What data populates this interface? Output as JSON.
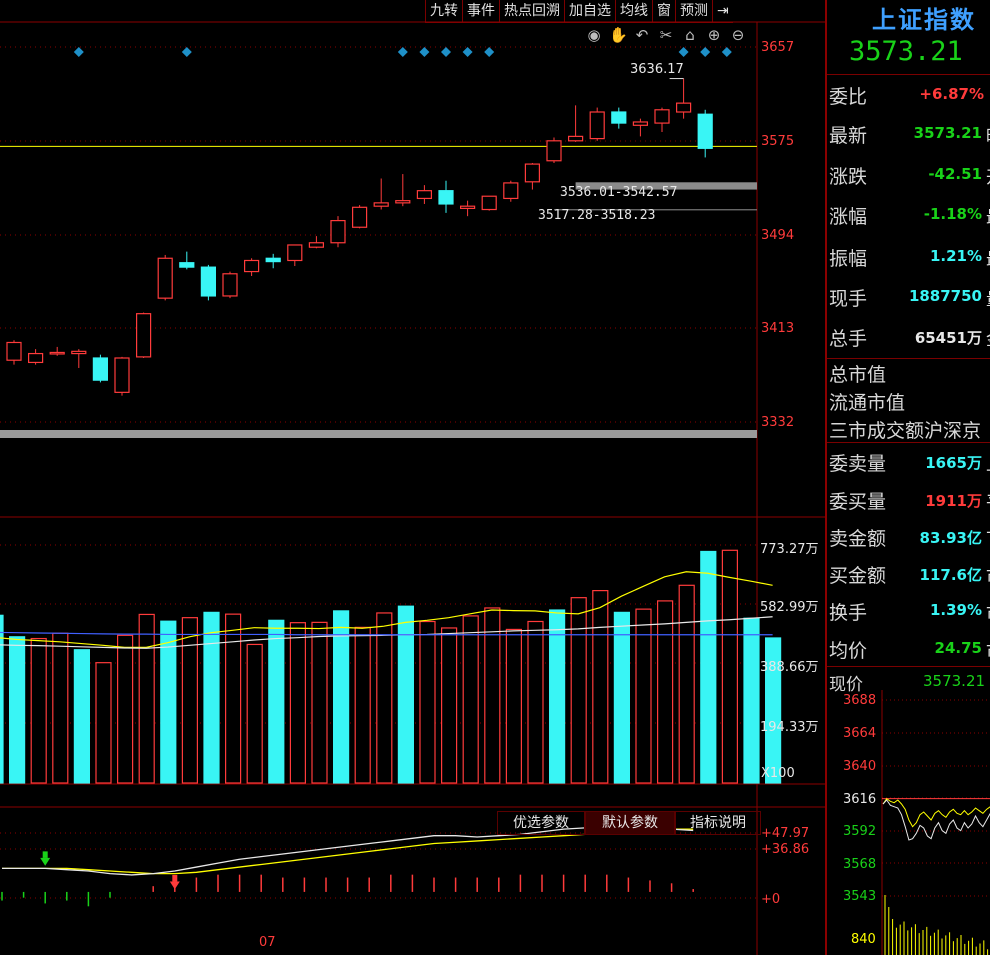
{
  "toolbar": {
    "items": [
      "九转",
      "事件",
      "热点回溯",
      "加自选",
      "均线",
      "窗",
      "预测",
      "⇥"
    ]
  },
  "chart_icons": [
    "eye-icon",
    "hand-icon",
    "undo-icon",
    "scissors-icon",
    "lock-icon",
    "zoom-in-icon",
    "zoom-out-icon"
  ],
  "colors": {
    "up": "#ff3b3b",
    "down": "#39f5f5",
    "ma_yellow": "#ffff00",
    "ma_white": "#e8e8e8",
    "ma_blue": "#4060ff",
    "grid": "#8b0000",
    "signal": "#1e90c8"
  },
  "chart_data": [
    {
      "type": "candlestick",
      "price_axis_ticks": [
        "3657",
        "3575",
        "3494",
        "3413",
        "3332"
      ],
      "ylim": [
        3310,
        3680
      ],
      "high_label": "3636.17",
      "gap_labels": [
        "3536.01-3542.57",
        "3517.28-3518.23"
      ],
      "gap_zones": [
        [
          3536.01,
          3542.57
        ],
        [
          3517.28,
          3518.23
        ]
      ],
      "reference_level": 3575,
      "signal_marker_bars": [
        3,
        8,
        18,
        19,
        20,
        21,
        22,
        31,
        32,
        33
      ],
      "candles": [
        {
          "o": 3382,
          "h": 3400,
          "l": 3378,
          "c": 3398
        },
        {
          "o": 3380,
          "h": 3392,
          "l": 3378,
          "c": 3388
        },
        {
          "o": 3388,
          "h": 3394,
          "l": 3386,
          "c": 3389
        },
        {
          "o": 3388,
          "h": 3392,
          "l": 3375,
          "c": 3390
        },
        {
          "o": 3384,
          "h": 3387,
          "l": 3362,
          "c": 3364
        },
        {
          "o": 3353,
          "h": 3385,
          "l": 3350,
          "c": 3384
        },
        {
          "o": 3385,
          "h": 3425,
          "l": 3384,
          "c": 3424
        },
        {
          "o": 3438,
          "h": 3477,
          "l": 3436,
          "c": 3474
        },
        {
          "o": 3470,
          "h": 3480,
          "l": 3464,
          "c": 3466
        },
        {
          "o": 3466,
          "h": 3468,
          "l": 3436,
          "c": 3440
        },
        {
          "o": 3440,
          "h": 3462,
          "l": 3438,
          "c": 3460
        },
        {
          "o": 3462,
          "h": 3474,
          "l": 3458,
          "c": 3472
        },
        {
          "o": 3474,
          "h": 3478,
          "l": 3465,
          "c": 3471
        },
        {
          "o": 3472,
          "h": 3479,
          "l": 3467,
          "c": 3486
        },
        {
          "o": 3484,
          "h": 3494,
          "l": 3483,
          "c": 3488
        },
        {
          "o": 3488,
          "h": 3512,
          "l": 3484,
          "c": 3508
        },
        {
          "o": 3502,
          "h": 3522,
          "l": 3501,
          "c": 3520
        },
        {
          "o": 3521,
          "h": 3546,
          "l": 3518,
          "c": 3524
        },
        {
          "o": 3524,
          "h": 3550,
          "l": 3521,
          "c": 3526
        },
        {
          "o": 3528,
          "h": 3540,
          "l": 3523,
          "c": 3535
        },
        {
          "o": 3535,
          "h": 3544,
          "l": 3515,
          "c": 3523
        },
        {
          "o": 3519,
          "h": 3526,
          "l": 3512,
          "c": 3521
        },
        {
          "o": 3518,
          "h": 3530,
          "l": 3517,
          "c": 3530
        },
        {
          "o": 3528,
          "h": 3544,
          "l": 3525,
          "c": 3542
        },
        {
          "o": 3543,
          "h": 3560,
          "l": 3536,
          "c": 3559
        },
        {
          "o": 3562,
          "h": 3583,
          "l": 3560,
          "c": 3580
        },
        {
          "o": 3580,
          "h": 3612,
          "l": 3579,
          "c": 3584
        },
        {
          "o": 3582,
          "h": 3610,
          "l": 3580,
          "c": 3606
        },
        {
          "o": 3606,
          "h": 3610,
          "l": 3591,
          "c": 3596
        },
        {
          "o": 3594,
          "h": 3600,
          "l": 3584,
          "c": 3597
        },
        {
          "o": 3596,
          "h": 3610,
          "l": 3588,
          "c": 3608
        },
        {
          "o": 3606,
          "h": 3636.17,
          "l": 3600,
          "c": 3614
        },
        {
          "o": 3604,
          "h": 3608,
          "l": 3565,
          "c": 3573.21
        }
      ]
    },
    {
      "type": "bar",
      "volume_axis_ticks": [
        "773.27万",
        "582.99万",
        "388.66万",
        "194.33万"
      ],
      "unit_label": "X100",
      "ylim": [
        0,
        860
      ],
      "values": [
        570,
        497,
        491,
        509,
        453,
        409,
        502,
        573,
        550,
        562,
        580,
        574,
        471,
        553,
        545,
        546,
        585,
        529,
        578,
        601,
        549,
        527,
        568,
        595,
        522,
        549,
        588,
        630,
        654,
        580,
        591,
        619,
        672,
        787,
        791,
        560,
        493
      ],
      "up_bars": [
        0,
        0,
        1,
        1,
        0,
        1,
        1,
        1,
        0,
        1,
        0,
        1,
        1,
        0,
        1,
        1,
        0,
        1,
        1,
        0,
        1,
        1,
        1,
        1,
        1,
        1,
        0,
        1,
        1,
        0,
        1,
        1,
        1,
        0,
        1,
        0,
        0
      ],
      "series": [
        {
          "values": [
            495,
            488,
            484,
            480,
            474,
            468,
            461,
            461,
            477,
            497,
            511,
            519,
            528,
            526,
            526,
            525,
            529,
            526,
            533,
            546,
            553,
            562,
            575,
            588,
            586,
            585,
            578,
            575,
            596,
            635,
            668,
            701,
            718,
            713,
            699,
            686,
            672
          ]
        },
        {
          "values": [
            470,
            468,
            467,
            465,
            463,
            461,
            459,
            458,
            462,
            468,
            474,
            480,
            486,
            491,
            494,
            498,
            500,
            501,
            502,
            504,
            505,
            508,
            511,
            514,
            517,
            519,
            521,
            524,
            529,
            533,
            537,
            541,
            546,
            551,
            555,
            560,
            565
          ]
        },
        {
          "values": [
            512,
            511,
            510,
            509,
            508,
            507,
            506,
            506,
            505,
            505,
            505,
            505,
            505,
            505,
            504,
            504,
            504,
            504,
            504,
            504,
            504,
            504,
            504,
            504,
            504,
            504,
            504,
            504,
            504,
            504,
            504,
            504,
            504,
            504,
            504,
            504,
            504
          ]
        }
      ]
    },
    {
      "type": "line",
      "indicator_axis_ticks": [
        "+47.97",
        "+36.86",
        "+0"
      ],
      "x_tick_label": "07",
      "ylim": [
        -10,
        55
      ],
      "series": [
        {
          "values": [
            18,
            18,
            18,
            18,
            17,
            16,
            15,
            14,
            14,
            15,
            17,
            19,
            21,
            23,
            25,
            27,
            29,
            31,
            33,
            35,
            37,
            38,
            39,
            40,
            41,
            42,
            43,
            44,
            45,
            46,
            47,
            48,
            47.97
          ]
        },
        {
          "values": [
            18,
            18,
            18,
            17,
            16,
            14,
            13,
            14,
            16,
            19,
            22,
            25,
            27,
            29,
            31,
            33,
            35,
            37,
            39,
            41,
            43,
            43,
            42,
            43,
            44,
            46,
            48,
            49,
            50,
            49,
            49,
            48,
            47
          ]
        }
      ],
      "hist": [
        -3,
        -2,
        -4,
        -3,
        -5,
        -2,
        0,
        2,
        4,
        5,
        6,
        6,
        6,
        5,
        5,
        5,
        5,
        5,
        6,
        6,
        5,
        5,
        5,
        5,
        6,
        6,
        6,
        6,
        6,
        5,
        4,
        3,
        1
      ],
      "buy_signal_bar": 8,
      "sell_signal_bar": 2
    },
    {
      "type": "line",
      "minute_axis_ticks": [
        "3688",
        "3664",
        "3640",
        "3616",
        "3592",
        "3568",
        "3543",
        "840"
      ],
      "ylim": [
        3540,
        3690
      ],
      "series": [
        {
          "values": [
            3612,
            3616,
            3614,
            3613,
            3615,
            3612,
            3608,
            3600,
            3595,
            3598,
            3604,
            3606,
            3603,
            3600,
            3605,
            3607,
            3604,
            3602,
            3606,
            3608,
            3605,
            3604,
            3607,
            3604,
            3606,
            3609,
            3607,
            3605,
            3608,
            3610
          ]
        },
        {
          "values": [
            3612,
            3615,
            3611,
            3610,
            3609,
            3604,
            3595,
            3585,
            3586,
            3590,
            3596,
            3594,
            3588,
            3586,
            3594,
            3598,
            3592,
            3590,
            3597,
            3600,
            3594,
            3592,
            3598,
            3594,
            3597,
            3603,
            3598,
            3595,
            3600,
            3605
          ]
        }
      ]
    }
  ],
  "indicator_tabs": [
    "优选参数",
    "默认参数",
    "指标说明"
  ],
  "panel": {
    "index_name": "上证指数",
    "index_price": "3573.21",
    "rows": [
      {
        "label": "委比",
        "value": "+6.87%",
        "cut": ""
      },
      {
        "label": "最新",
        "value": "3573.21",
        "cut": "昨"
      },
      {
        "label": "涨跌",
        "value": "-42.51",
        "cut": "开"
      },
      {
        "label": "涨幅",
        "value": "-1.18%",
        "cut": "最"
      },
      {
        "label": "振幅",
        "value": "1.21%",
        "cut": "最"
      },
      {
        "label": "现手",
        "value": "1887750",
        "cut": "量"
      },
      {
        "label": "总手",
        "value": "65451万",
        "cut": "金"
      }
    ],
    "market": [
      "总市值",
      "流通市值",
      "三市成交额沪深京"
    ],
    "rows2": [
      {
        "label": "委卖量",
        "value": "1665万",
        "cut": "上"
      },
      {
        "label": "委买量",
        "value": "1911万",
        "cut": "平"
      },
      {
        "label": "卖金额",
        "value": "83.93亿",
        "cut": "下"
      },
      {
        "label": "买金额",
        "value": "117.6亿",
        "cut": "市"
      },
      {
        "label": "换手",
        "value": "1.39%",
        "cut": "市"
      },
      {
        "label": "均价",
        "value": "24.75",
        "cut": "市"
      }
    ],
    "current_label": "现价",
    "current_value": "3573.21"
  }
}
